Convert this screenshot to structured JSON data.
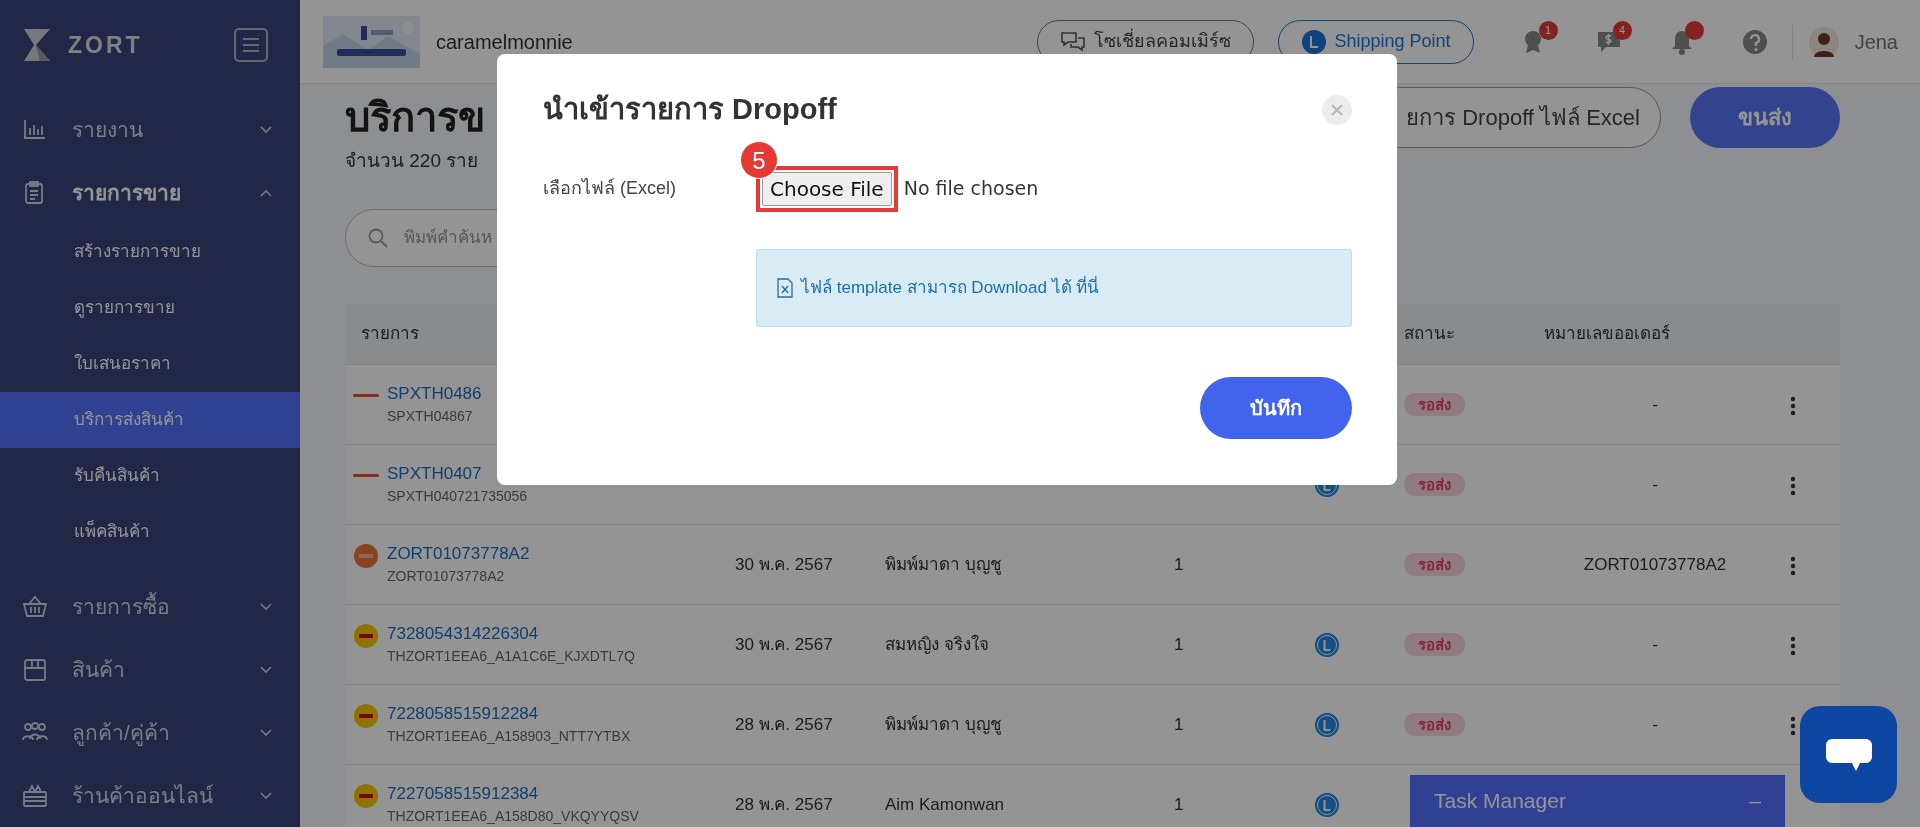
{
  "sidebar": {
    "brand": "ZORT",
    "items": [
      {
        "label": "รายงาน",
        "expanded": false
      },
      {
        "label": "รายการขาย",
        "expanded": true,
        "children": [
          {
            "label": "สร้างรายการขาย",
            "selected": false
          },
          {
            "label": "ดูรายการขาย",
            "selected": false
          },
          {
            "label": "ใบเสนอราคา",
            "selected": false
          },
          {
            "label": "บริการส่งสินค้า",
            "selected": true
          },
          {
            "label": "รับคืนสินค้า",
            "selected": false
          },
          {
            "label": "แพ็คสินค้า",
            "selected": false
          }
        ]
      },
      {
        "label": "รายการซื้อ",
        "expanded": false
      },
      {
        "label": "สินค้า",
        "expanded": false
      },
      {
        "label": "ลูกค้า/คู่ค้า",
        "expanded": false
      },
      {
        "label": "ร้านค้าออนไลน์",
        "expanded": false
      }
    ]
  },
  "topbar": {
    "store_name": "caramelmonnie",
    "social_button": "โซเชี่ยลคอมเมิร์ซ",
    "shipping_point_button": "Shipping Point",
    "badges": [
      "1",
      "4"
    ],
    "bell_dot": true,
    "user": "Jena"
  },
  "page": {
    "title": "บริการข",
    "count": "จำนวน 220 ราย",
    "search_placeholder": "พิมพ์คำค้นห",
    "import_button": "ยการ Dropoff ไฟล์ Excel",
    "ship_button": "ขนส่ง"
  },
  "table": {
    "columns": [
      "รายการ",
      "สถานะ",
      "หมายเลขออเดอร์"
    ],
    "rows": [
      {
        "kind": "shopee",
        "tracking": "SPXTH0486",
        "ref": "SPXTH04867",
        "shipping_point": false,
        "status": "รอส่ง",
        "order_no": "-",
        "menu": true
      },
      {
        "kind": "shopee",
        "tracking": "SPXTH0407",
        "ref": "SPXTH040721735056",
        "shipping_point": true,
        "status": "รอส่ง",
        "order_no": "-",
        "menu": true
      },
      {
        "kind": "zort",
        "tracking": "ZORT01073778A2",
        "ref": "ZORT01073778A2",
        "date": "30 พ.ค. 2567",
        "customer": "พิมพ์มาดา บุญชู",
        "qty": "1",
        "shipping_point": false,
        "status": "รอส่ง",
        "order_no": "ZORT01073778A2",
        "menu": true
      },
      {
        "kind": "dhl",
        "tracking": "7328054314226304",
        "ref": "THZORT1EEA6_A1A1C6E_KJXDTL7Q",
        "date": "30 พ.ค. 2567",
        "customer": "สมหญิง จริงใจ",
        "qty": "1",
        "shipping_point": true,
        "status": "รอส่ง",
        "order_no": "-",
        "menu": true
      },
      {
        "kind": "dhl",
        "tracking": "7228058515912284",
        "ref": "THZORT1EEA6_A158903_NTT7YTBX",
        "date": "28 พ.ค. 2567",
        "customer": "พิมพ์มาดา บุญชู",
        "qty": "1",
        "shipping_point": true,
        "status": "รอส่ง",
        "order_no": "-",
        "menu": true
      },
      {
        "kind": "dhl",
        "tracking": "7227058515912384",
        "ref": "THZORT1EEA6_A158D80_VKQYYQSV",
        "date": "28 พ.ค. 2567",
        "customer": "Aim Kamonwan",
        "qty": "1",
        "shipping_point": true,
        "menu": false
      }
    ]
  },
  "modal": {
    "title": "นำเข้ารายการ Dropoff",
    "file_label": "เลือกไฟล์ (Excel)",
    "choose_button": "Choose File",
    "file_status": "No file chosen",
    "step": "5",
    "info": "ไฟล์ template สามารถ Download ได้ ที่นี่",
    "save_button": "บันทึก"
  },
  "task_manager": {
    "title": "Task Manager",
    "toggle": "–"
  }
}
